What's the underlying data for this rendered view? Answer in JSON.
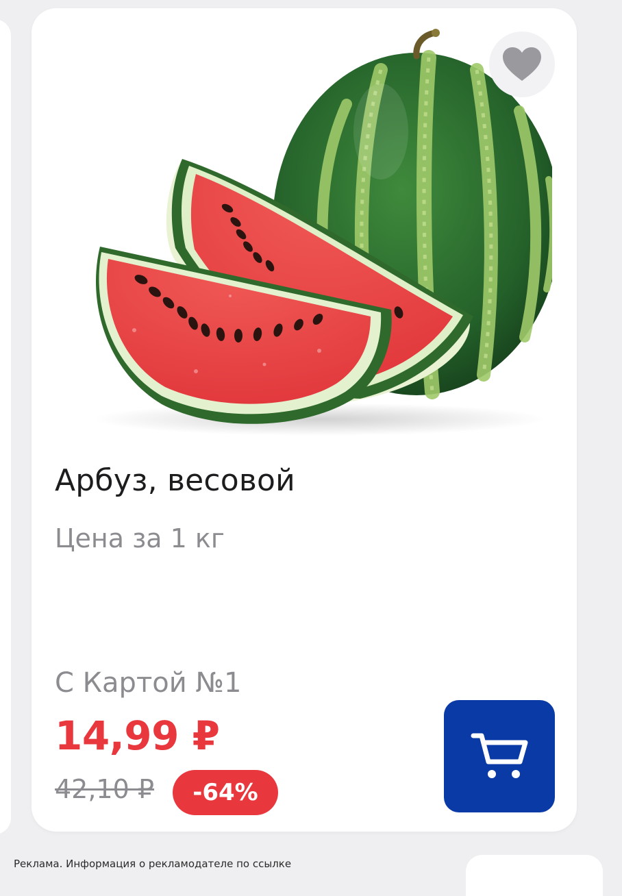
{
  "product": {
    "title": "Арбуз, весовой",
    "unit_note": "Цена за 1 кг",
    "image_icon": "watermarked-product-photo-watermelon"
  },
  "pricing": {
    "card_label": "С Картой №1",
    "current_price": "14,99 ₽",
    "old_price": "42,10 ₽",
    "discount": "-64%",
    "accent_color": "#e8383e"
  },
  "actions": {
    "favorite_icon": "heart-icon",
    "cart_icon": "cart-icon",
    "cart_color": "#0a3aa6"
  },
  "footer": {
    "ad_note": "Реклама. Информация о рекламодателе по ссылке"
  }
}
